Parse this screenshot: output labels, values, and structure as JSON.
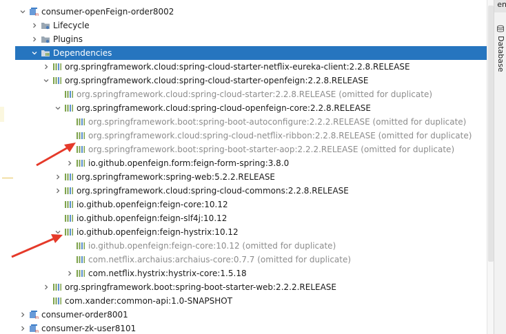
{
  "right_strip": {
    "top_tab_label": "en",
    "database_tab_label": "Database"
  },
  "tree": {
    "rows": [
      {
        "label": "consumer-openFeign-order8002",
        "arrow": "down",
        "icon": "module",
        "depth": 0
      },
      {
        "label": "Lifecycle",
        "arrow": "right",
        "icon": "folder-gear",
        "depth": 1
      },
      {
        "label": "Plugins",
        "arrow": "right",
        "icon": "folder-gear",
        "depth": 1
      },
      {
        "label": "Dependencies",
        "arrow": "down",
        "icon": "folder-lib",
        "depth": 1,
        "selected": true
      },
      {
        "label": "org.springframework.cloud:spring-cloud-starter-netflix-eureka-client:2.2.8.RELEASE",
        "arrow": "right",
        "icon": "library",
        "depth": 2
      },
      {
        "label": "org.springframework.cloud:spring-cloud-starter-openfeign:2.2.8.RELEASE",
        "arrow": "down",
        "icon": "library",
        "depth": 2
      },
      {
        "label": "org.springframework.cloud:spring-cloud-starter:2.2.8.RELEASE (omitted for duplicate)",
        "arrow": "none",
        "icon": "library",
        "depth": 3,
        "dim": true
      },
      {
        "label": "org.springframework.cloud:spring-cloud-openfeign-core:2.2.8.RELEASE",
        "arrow": "down",
        "icon": "library",
        "depth": 3
      },
      {
        "label": "org.springframework.boot:spring-boot-autoconfigure:2.2.2.RELEASE (omitted for duplicate)",
        "arrow": "none",
        "icon": "library",
        "depth": 4,
        "dim": true
      },
      {
        "label": "org.springframework.cloud:spring-cloud-netflix-ribbon:2.2.8.RELEASE (omitted for duplicate)",
        "arrow": "none",
        "icon": "library",
        "depth": 4,
        "dim": true
      },
      {
        "label": "org.springframework.boot:spring-boot-starter-aop:2.2.2.RELEASE (omitted for duplicate)",
        "arrow": "none",
        "icon": "library",
        "depth": 4,
        "dim": true
      },
      {
        "label": "io.github.openfeign.form:feign-form-spring:3.8.0",
        "arrow": "right",
        "icon": "library",
        "depth": 4
      },
      {
        "label": "org.springframework:spring-web:5.2.2.RELEASE",
        "arrow": "right",
        "icon": "library",
        "depth": 3
      },
      {
        "label": "org.springframework.cloud:spring-cloud-commons:2.2.8.RELEASE",
        "arrow": "right",
        "icon": "library",
        "depth": 3
      },
      {
        "label": "io.github.openfeign:feign-core:10.12",
        "arrow": "none",
        "icon": "library",
        "depth": 3
      },
      {
        "label": "io.github.openfeign:feign-slf4j:10.12",
        "arrow": "none",
        "icon": "library",
        "depth": 3
      },
      {
        "label": "io.github.openfeign:feign-hystrix:10.12",
        "arrow": "down",
        "icon": "library",
        "depth": 3
      },
      {
        "label": "io.github.openfeign:feign-core:10.12 (omitted for duplicate)",
        "arrow": "none",
        "icon": "library",
        "depth": 4,
        "dim": true
      },
      {
        "label": "com.netflix.archaius:archaius-core:0.7.7 (omitted for duplicate)",
        "arrow": "none",
        "icon": "library",
        "depth": 4,
        "dim": true
      },
      {
        "label": "com.netflix.hystrix:hystrix-core:1.5.18",
        "arrow": "right",
        "icon": "library",
        "depth": 4
      },
      {
        "label": "org.springframework.boot:spring-boot-starter-web:2.2.2.RELEASE",
        "arrow": "right",
        "icon": "library",
        "depth": 2
      },
      {
        "label": "com.xander:common-api:1.0-SNAPSHOT",
        "arrow": "none",
        "icon": "library",
        "depth": 2
      },
      {
        "label": "consumer-order8001",
        "arrow": "right",
        "icon": "module",
        "depth": 0
      },
      {
        "label": "consumer-zk-user8101",
        "arrow": "right",
        "icon": "module",
        "depth": 0
      }
    ]
  },
  "colors": {
    "selection": "#2675bf",
    "dim_text": "#8c8c8c",
    "annotation_arrow": "#e53a2a",
    "library_icon": "#7da24b",
    "module_icon": "#3f7fc8"
  }
}
